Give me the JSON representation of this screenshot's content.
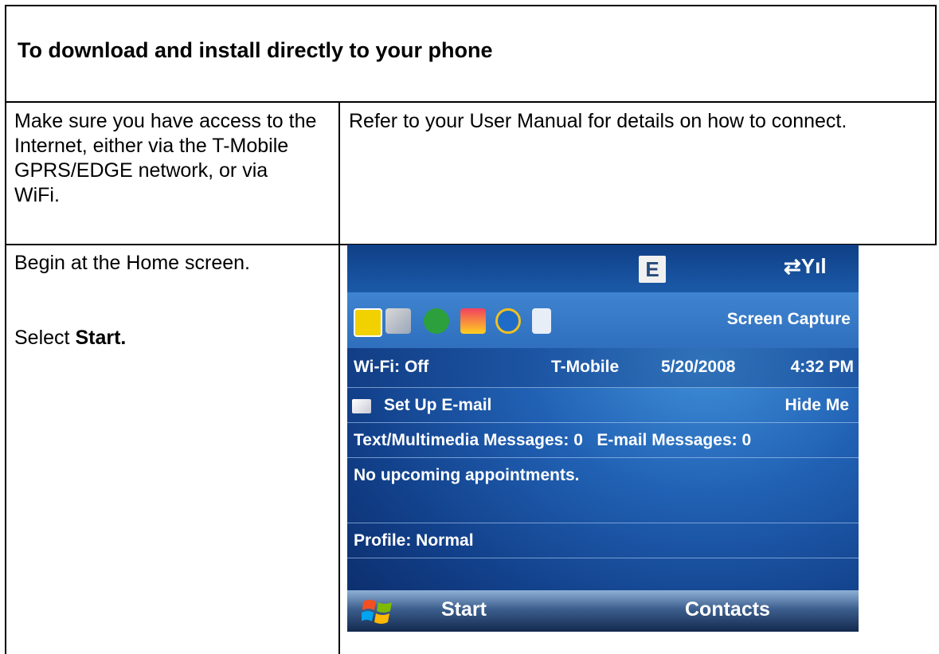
{
  "heading": "To download and install directly to your phone",
  "rows": [
    {
      "left_text": "Make sure you have access to the Internet, either via the T-Mobile GPRS/EDGE network, or via WiFi.",
      "right_text": "Refer to your User Manual for details on how to connect."
    },
    {
      "left_line1": "Begin at the Home screen.",
      "left_prefix": "Select ",
      "left_bold": "Start."
    }
  ],
  "phone": {
    "network_badge": "E",
    "signal_glyph": "⇄Yıl",
    "screen_capture": "Screen Capture",
    "wifi": "Wi-Fi: Off",
    "carrier": "T-Mobile",
    "date": "5/20/2008",
    "time": "4:32 PM",
    "setup_email": "Set Up E-mail",
    "hide_me": "Hide Me",
    "messages": "Text/Multimedia Messages: 0   E-mail Messages: 0",
    "appointments": "No upcoming appointments.",
    "profile": "Profile: Normal",
    "softkey_left": "Start",
    "softkey_right": "Contacts"
  }
}
